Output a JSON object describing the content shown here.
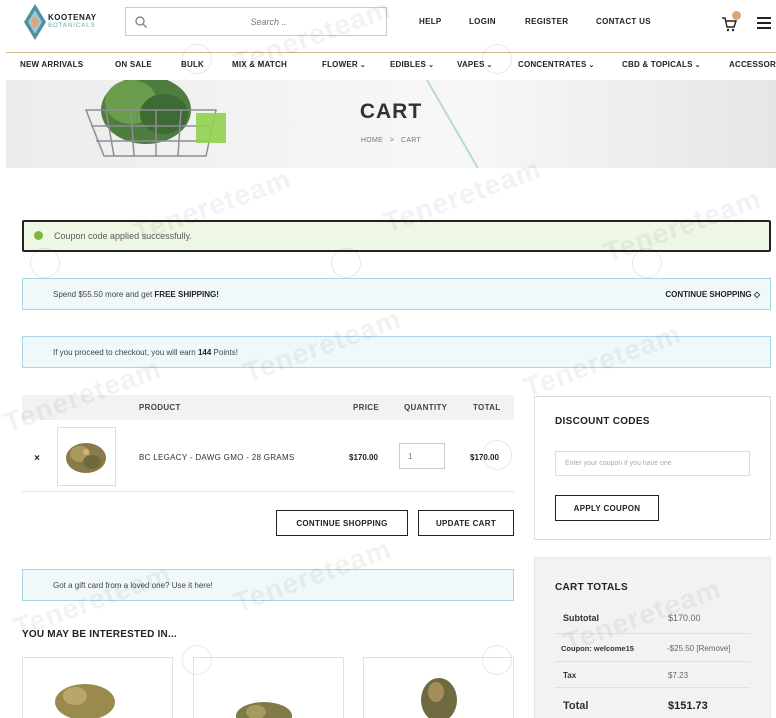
{
  "brand": {
    "name": "KOOTENAY",
    "sub": "BOTANICALS",
    "colors": {
      "accent": "#d4b58c",
      "success_bg": "#eef7e3",
      "info_bg": "#f0f8fc",
      "info_border": "#a9d4e6"
    }
  },
  "search": {
    "placeholder": "Search ..",
    "icon": "search-icon"
  },
  "top_links": {
    "help": "HELP",
    "login": "LOGIN",
    "register": "REGISTER",
    "contact": "CONTACT US"
  },
  "nav": {
    "new_arrivals": "NEW ARRIVALS",
    "on_sale": "ON SALE",
    "bulk": "BULK",
    "mix_match": "MIX & MATCH",
    "flower": "FLOWER",
    "edibles": "EDIBLES",
    "vapes": "VAPES",
    "concentrates": "CONCENTRATES",
    "cbd": "CBD & TOPICALS",
    "accessories": "ACCESSOR"
  },
  "hero": {
    "title": "CART",
    "breadcrumb_home": "HOME",
    "breadcrumb_sep": ">",
    "breadcrumb_current": "CART"
  },
  "notices": {
    "success": "Coupon code applied successfully.",
    "shipping_pre": "Spend $55.50 more and get ",
    "shipping_bold": "FREE SHIPPING!",
    "continue": "CONTINUE SHOPPING",
    "points_pre": "If you proceed to checkout, you will earn ",
    "points_bold": "144",
    "points_post": " Points!"
  },
  "cart": {
    "headers": {
      "product": "PRODUCT",
      "price": "PRICE",
      "quantity": "QUANTITY",
      "total": "TOTAL"
    },
    "items": [
      {
        "remove": "×",
        "name": "BC LEGACY - DAWG GMO - 28 GRAMS",
        "price": "$170.00",
        "quantity": "1",
        "total": "$170.00"
      }
    ],
    "continue_button": "CONTINUE SHOPPING",
    "update_button": "UPDATE CART"
  },
  "gift": {
    "text": "Got a gift card from a loved one? Use it here!"
  },
  "related": {
    "title": "YOU MAY BE INTERESTED IN..."
  },
  "discount": {
    "title": "DISCOUNT CODES",
    "placeholder": "Enter your coupon if you have one",
    "apply_button": "APPLY COUPON"
  },
  "totals": {
    "title": "CART TOTALS",
    "subtotal_label": "Subtotal",
    "subtotal_value": "$170.00",
    "coupon_label": "Coupon: welcome15",
    "coupon_value": "-$25.50 [Remove]",
    "tax_label": "Tax",
    "tax_value": "$7.23",
    "total_label": "Total",
    "total_value": "$151.73"
  },
  "watermark": {
    "text": "Tenereteam"
  }
}
